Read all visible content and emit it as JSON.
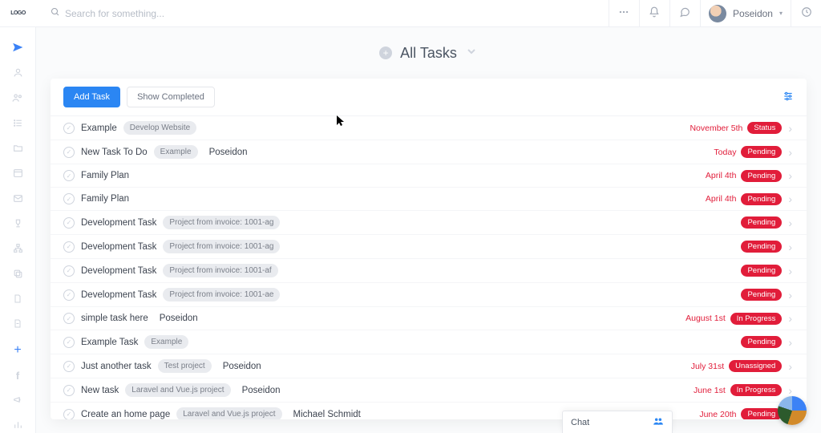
{
  "topbar": {
    "logo_text": "LOGO",
    "search_placeholder": "Search for something...",
    "user_name": "Poseidon"
  },
  "page": {
    "title": "All Tasks"
  },
  "toolbar": {
    "add_label": "Add Task",
    "show_completed_label": "Show Completed"
  },
  "tasks": [
    {
      "title": "Example",
      "project": "Develop Website",
      "assignee": "",
      "due": "November 5th",
      "status": "Status"
    },
    {
      "title": "New Task To Do",
      "project": "Example",
      "assignee": "Poseidon",
      "due": "Today",
      "status": "Pending"
    },
    {
      "title": "Family Plan",
      "project": "",
      "assignee": "",
      "due": "April 4th",
      "status": "Pending"
    },
    {
      "title": "Family Plan",
      "project": "",
      "assignee": "",
      "due": "April 4th",
      "status": "Pending"
    },
    {
      "title": "Development Task",
      "project": "Project from invoice: 1001-ag",
      "assignee": "",
      "due": "",
      "status": "Pending"
    },
    {
      "title": "Development Task",
      "project": "Project from invoice: 1001-ag",
      "assignee": "",
      "due": "",
      "status": "Pending"
    },
    {
      "title": "Development Task",
      "project": "Project from invoice: 1001-af",
      "assignee": "",
      "due": "",
      "status": "Pending"
    },
    {
      "title": "Development Task",
      "project": "Project from invoice: 1001-ae",
      "assignee": "",
      "due": "",
      "status": "Pending"
    },
    {
      "title": "simple task here",
      "project": "",
      "assignee": "Poseidon",
      "due": "August 1st",
      "status": "In Progress"
    },
    {
      "title": "Example Task",
      "project": "Example",
      "assignee": "",
      "due": "",
      "status": "Pending"
    },
    {
      "title": "Just another task",
      "project": "Test project",
      "assignee": "Poseidon",
      "due": "July 31st",
      "status": "Unassigned"
    },
    {
      "title": "New task",
      "project": "Laravel and Vue.js project",
      "assignee": "Poseidon",
      "due": "June 1st",
      "status": "In Progress"
    },
    {
      "title": "Create an home page",
      "project": "Laravel and Vue.js project",
      "assignee": "Michael Schmidt",
      "due": "June 20th",
      "status": "Pending"
    }
  ],
  "chat": {
    "label": "Chat"
  }
}
